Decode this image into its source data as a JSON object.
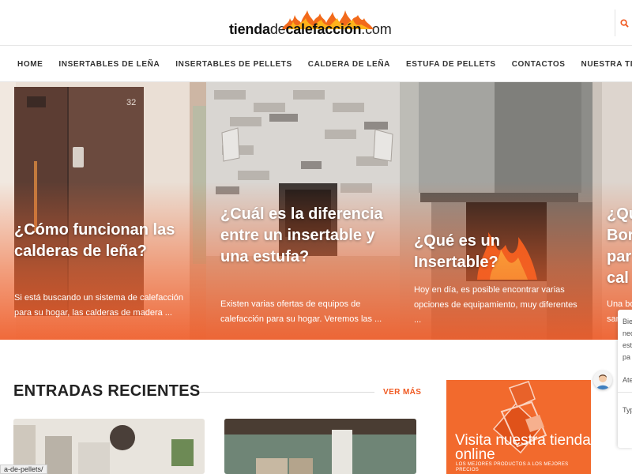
{
  "site": {
    "logo_part1": "tienda",
    "logo_part2": "de",
    "logo_part3": "calefacción",
    "logo_part4": ".com"
  },
  "header": {
    "search_icon": "search-icon"
  },
  "nav": {
    "items": [
      "HOME",
      "INSERTABLES DE LEÑA",
      "INSERTABLES DE PELLETS",
      "CALDERA DE LEÑA",
      "ESTUFA DE PELLETS",
      "CONTACTOS",
      "NUESTRA TIENDA ONLINE"
    ]
  },
  "slider": {
    "slides": [
      {
        "title": "¿Cómo funcionan las calderas de leña?",
        "excerpt": "Si está buscando un sistema de calefacción para su hogar, las calderas de madera ...",
        "badge": "32"
      },
      {
        "title": "¿Cuál es la diferencia entre un insertable y una estufa?",
        "excerpt": "Existen varias ofertas de equipos de calefacción para su hogar. Veremos las ..."
      },
      {
        "title": "¿Qué es un Insertable?",
        "excerpt": "Hoy en día, es posible encontrar varias opciones de equipamiento, muy diferentes ..."
      },
      {
        "title": "¿Qu Bor par cal",
        "excerpt": "Una bo sar"
      }
    ]
  },
  "recent": {
    "title": "ENTRADAS RECIENTES",
    "more_label": "VER MÁS"
  },
  "ad": {
    "headline": "Visita nuestra tienda online",
    "subline": "LOS MEJORES PRODUCTOS A LOS MEJORES PRECIOS"
  },
  "chat": {
    "lines": [
      "Bie",
      "nec",
      "est",
      "pa"
    ],
    "attend": "Ate",
    "input_placeholder": "Typ"
  },
  "status_bar": {
    "url": "a-de-pellets/"
  },
  "colors": {
    "accent": "#f05a22",
    "ad_bg": "#f26a2d",
    "slide_overlay": "#f3642e"
  }
}
